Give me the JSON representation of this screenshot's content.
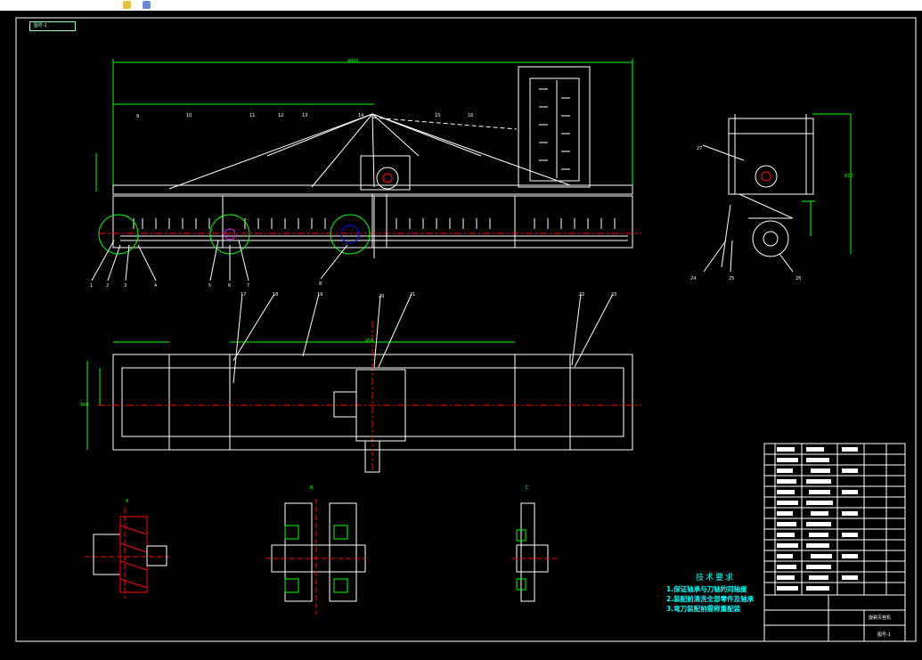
{
  "toolbar": {
    "icons": [
      "snap-icon",
      "layers-icon"
    ]
  },
  "drawing": {
    "tab_label": "图号-1",
    "dim_total": "4400",
    "dim_width": "960",
    "dim_segment": "450",
    "dim_height": "870",
    "views": {
      "a": "A",
      "b": "B",
      "c": "C"
    },
    "balloons_front": [
      "1",
      "2",
      "3",
      "4",
      "5",
      "6",
      "7",
      "8",
      "9",
      "10",
      "11",
      "12",
      "13",
      "14",
      "15",
      "16"
    ],
    "balloons_plan": [
      "17",
      "18",
      "19",
      "20",
      "21",
      "22",
      "23"
    ],
    "balloons_side": [
      "24",
      "25",
      "26",
      "27"
    ]
  },
  "tech": {
    "title": "技术要求",
    "lines": [
      "1.保证轴承与刀轴的同轴度",
      "2.装配前清洗全部零件及轴承",
      "3.弯刀装配前需称重配装"
    ]
  },
  "title_block": {
    "name": "旋耕灭茬机",
    "code": "图号-1"
  },
  "colors": {
    "bg": "#000000",
    "line": "#ffffff",
    "dim": "#00ff00",
    "center": "#ff0000",
    "accent": "#00ffff"
  }
}
